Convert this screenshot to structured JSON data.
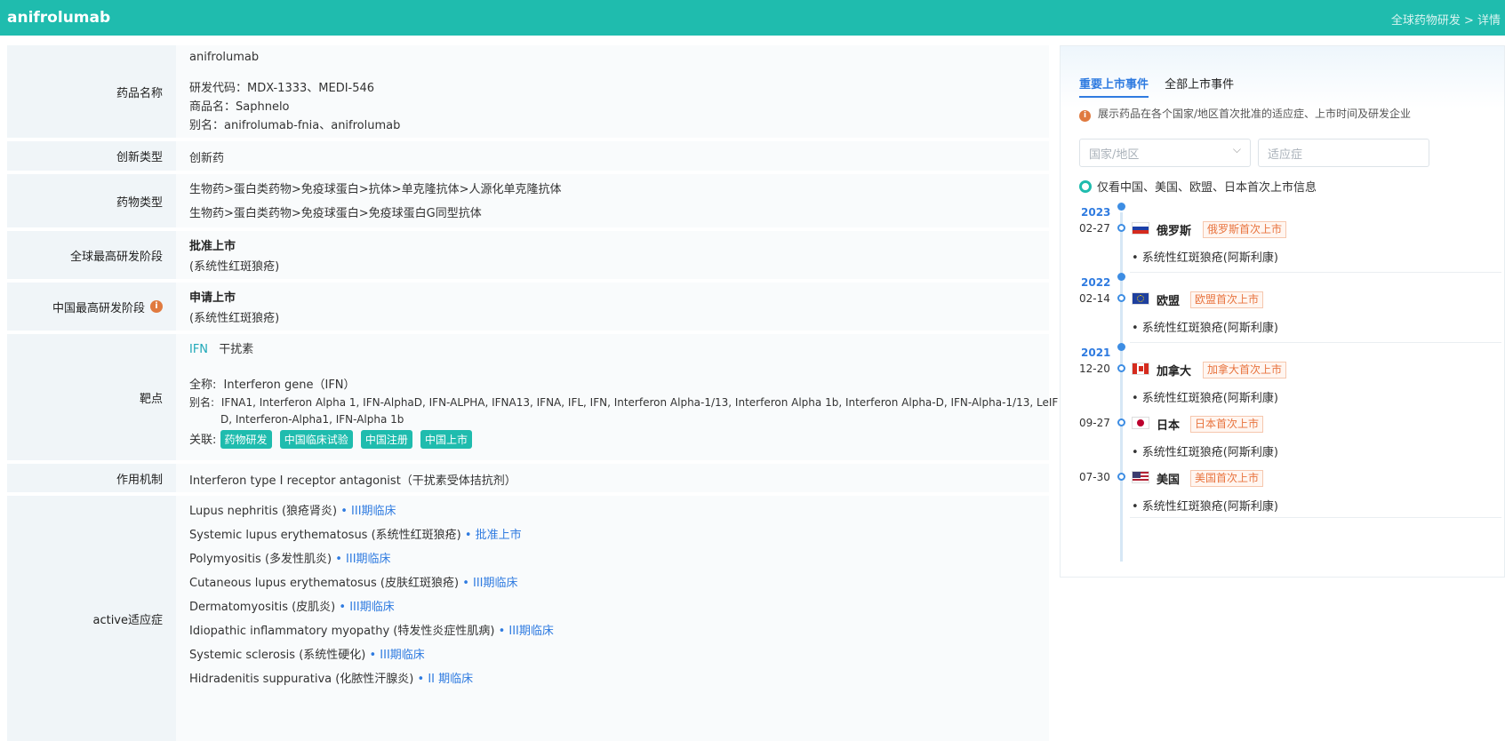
{
  "header": {
    "title": "anifrolumab",
    "breadcrumb": "全球药物研发 > 详情"
  },
  "detail": {
    "name_label": "药品名称",
    "name_main": "anifrolumab",
    "name_code": "研发代码：MDX-1333、MEDI-546",
    "name_trade": "商品名：Saphnelo",
    "name_alias": "别名：anifrolumab-fnia、anifrolumab",
    "innovation_label": "创新类型",
    "innovation_value": "创新药",
    "drugtype_label": "药物类型",
    "drugtype_values": [
      "生物药>蛋白类药物>免疫球蛋白>抗体>单克隆抗体>人源化单克隆抗体",
      "生物药>蛋白类药物>免疫球蛋白>免疫球蛋白G同型抗体"
    ],
    "global_stage_label": "全球最高研发阶段",
    "global_stage_value": "批准上市",
    "global_stage_note": "(系统性红斑狼疮)",
    "china_stage_label": "中国最高研发阶段",
    "china_stage_value": "申请上市",
    "china_stage_note": "(系统性红斑狼疮)",
    "target_label": "靶点",
    "target_code": "IFN",
    "target_cn": "干扰素",
    "target_fullname_key": "全称:",
    "target_fullname": "Interferon gene（IFN）",
    "target_alias_key": "别名:",
    "target_alias_1": "IFNA1, Interferon Alpha 1, IFN-AlphaD, IFN-ALPHA, IFNA13, IFNA, IFL, IFN, Interferon Alpha-1/13, Interferon Alpha 1b, Interferon Alpha-D, IFN-Alpha-1/13, LeIF",
    "target_alias_2": "D, Interferon-Alpha1, IFN-Alpha 1b",
    "target_related_key": "关联:",
    "target_badges": [
      "药物研发",
      "中国临床试验",
      "中国注册",
      "中国上市"
    ],
    "mechanism_label": "作用机制",
    "mechanism_value": "Interferon type I receptor antagonist（干扰素受体拮抗剂）",
    "indication_label": "active适应症",
    "indications": [
      {
        "name": "Lupus nephritis (狼疮肾炎)",
        "phase": "• III期临床"
      },
      {
        "name": "Systemic lupus erythematosus (系统性红斑狼疮)",
        "phase": "• 批准上市"
      },
      {
        "name": "Polymyositis (多发性肌炎)",
        "phase": "• III期临床"
      },
      {
        "name": "Cutaneous lupus erythematosus (皮肤红斑狼疮)",
        "phase": "• III期临床"
      },
      {
        "name": "Dermatomyositis (皮肌炎)",
        "phase": "• III期临床"
      },
      {
        "name": "Idiopathic inflammatory myopathy (特发性炎症性肌病)",
        "phase": "• III期临床"
      },
      {
        "name": "Systemic sclerosis (系统性硬化)",
        "phase": "• III期临床"
      },
      {
        "name": "Hidradenitis suppurativa (化脓性汗腺炎)",
        "phase": "• II 期临床"
      }
    ]
  },
  "panel": {
    "tabs": [
      "重要上市事件",
      "全部上市事件"
    ],
    "hint": "展示药品在各个国家/地区首次批准的适应症、上市时间及研发企业",
    "country_placeholder": "国家/地区",
    "indication_placeholder": "适应症",
    "radio_label": "仅看中国、美国、欧盟、日本首次上市信息",
    "years": [
      "2023",
      "2022",
      "2021"
    ],
    "events": [
      {
        "date": "02-27",
        "country": "俄罗斯",
        "badge": "俄罗斯首次上市",
        "indication": "• 系统性红斑狼疮(阿斯利康)"
      },
      {
        "date": "02-14",
        "country": "欧盟",
        "badge": "欧盟首次上市",
        "indication": "• 系统性红斑狼疮(阿斯利康)"
      },
      {
        "date": "12-20",
        "country": "加拿大",
        "badge": "加拿大首次上市",
        "indication": "• 系统性红斑狼疮(阿斯利康)"
      },
      {
        "date": "09-27",
        "country": "日本",
        "badge": "日本首次上市",
        "indication": "• 系统性红斑狼疮(阿斯利康)"
      },
      {
        "date": "07-30",
        "country": "美国",
        "badge": "美国首次上市",
        "indication": "• 系统性红斑狼疮(阿斯利康)"
      }
    ]
  }
}
